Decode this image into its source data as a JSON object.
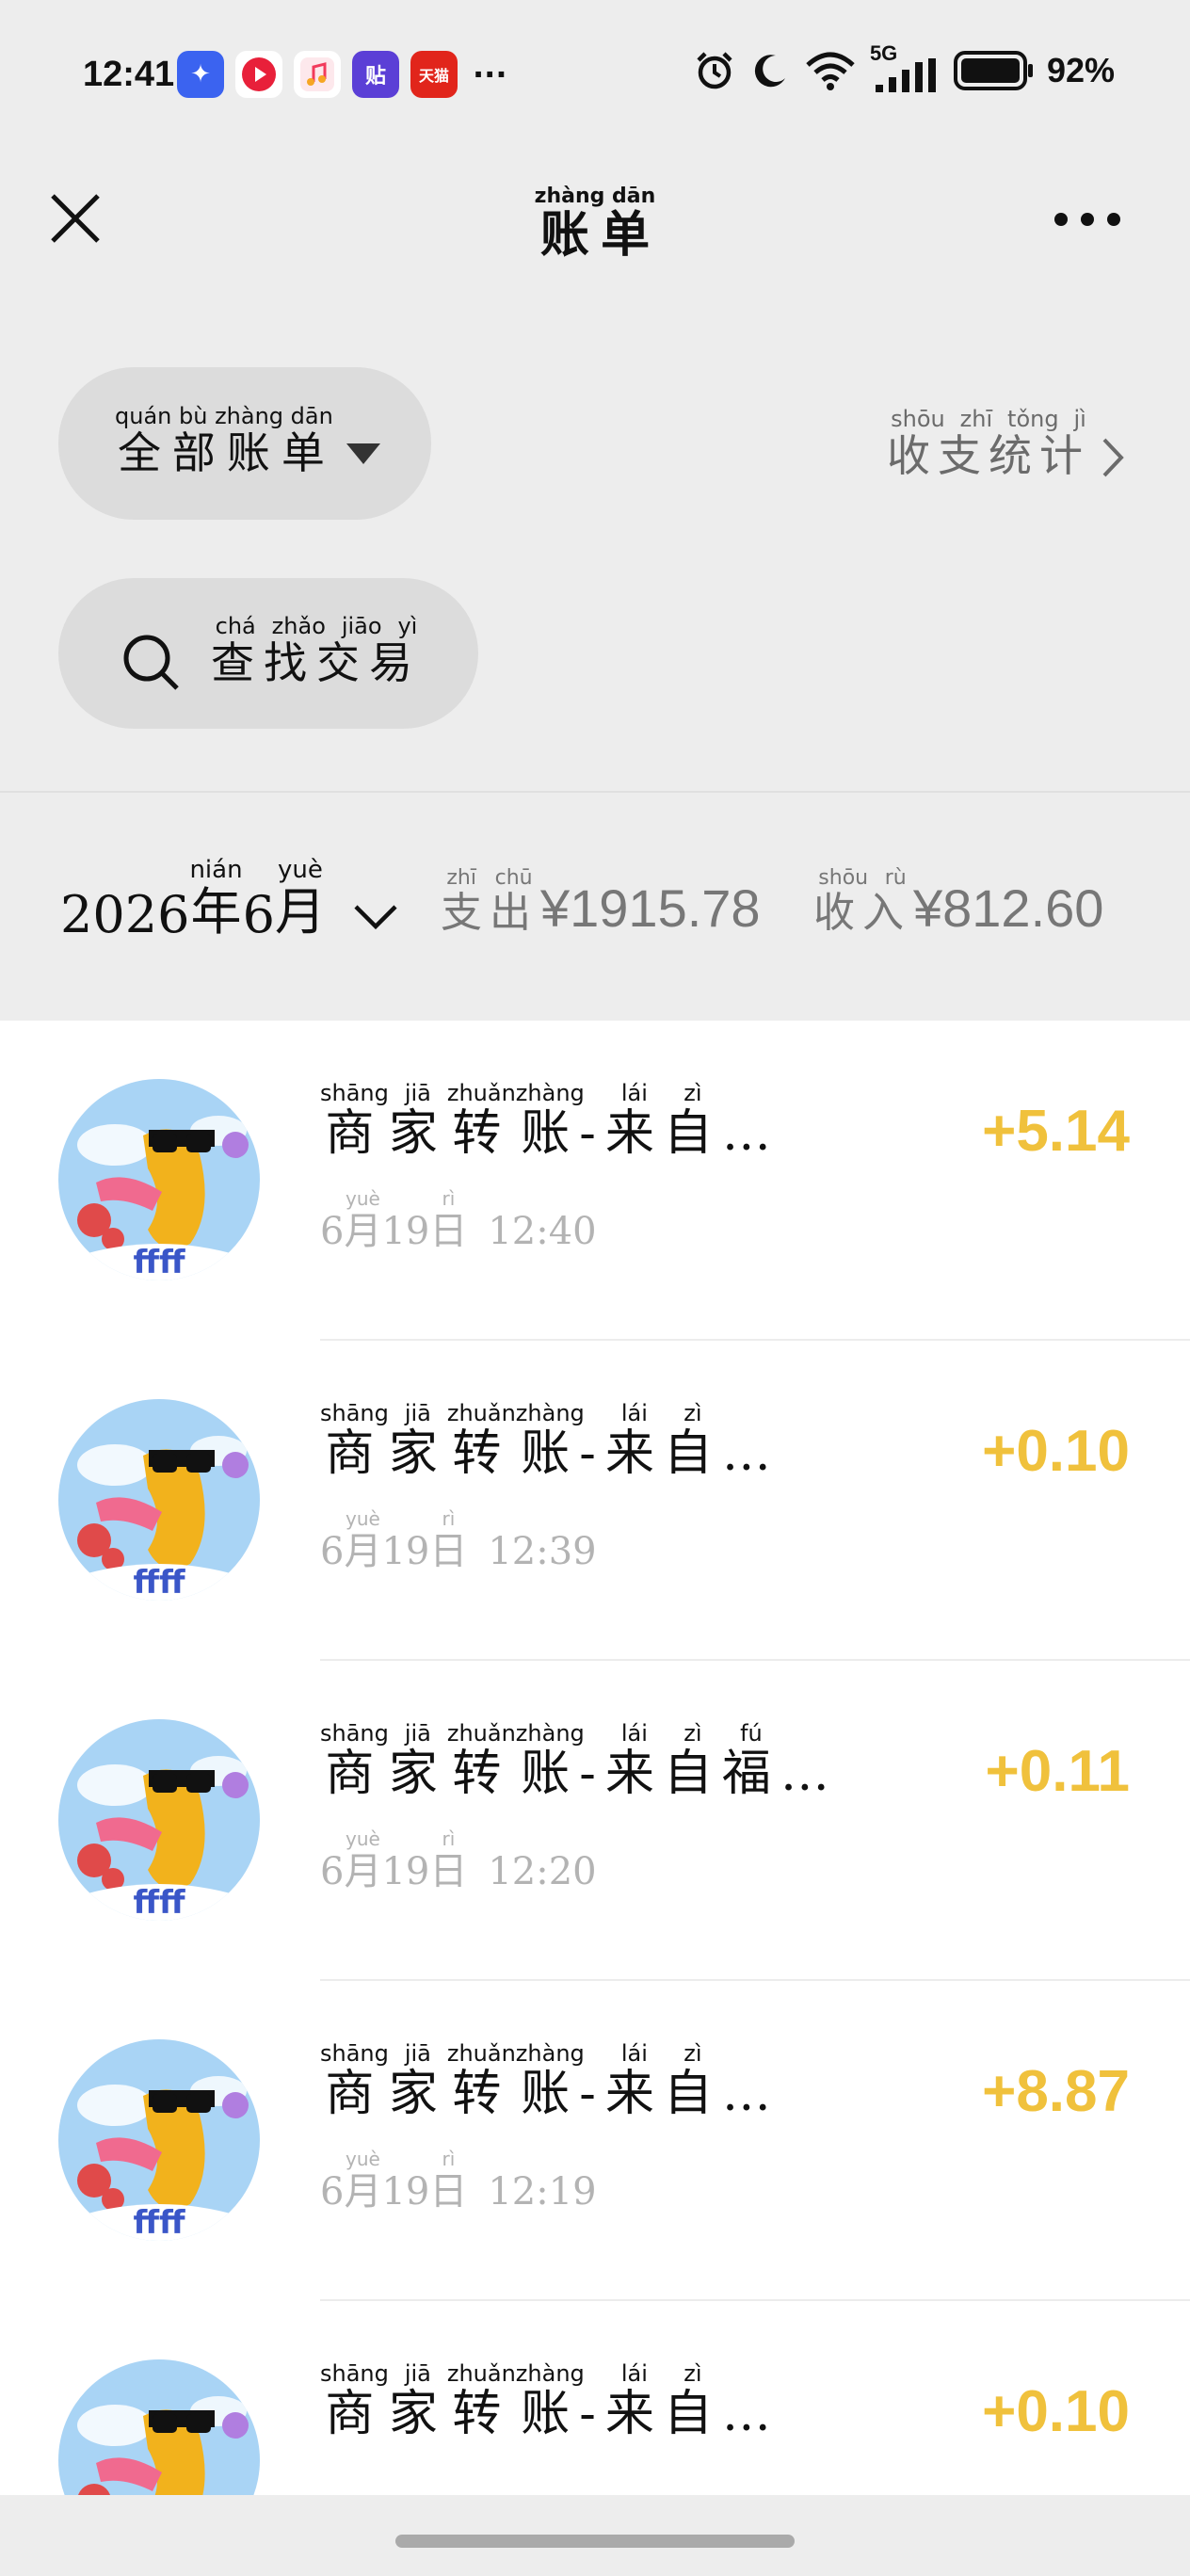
{
  "status_bar": {
    "time": "12:41",
    "network": "5G",
    "battery": "92%",
    "overflow": "···"
  },
  "nav": {
    "title": "账单",
    "title_pinyin": "zhàng dān"
  },
  "filter": {
    "all_bills": "全部账单",
    "all_bills_pinyin": "quán bù zhàng dān",
    "stats": "收支统计",
    "stats_pinyin": "shōu zhī tǒng jì",
    "search": "查找交易",
    "search_pinyin": "chá zhǎo jiāo yì"
  },
  "summary": {
    "year": "2026",
    "year_char": "年",
    "year_pinyin": "nián",
    "month": "6",
    "month_char": "月",
    "month_pinyin": "yuè",
    "expense_label": "支出",
    "expense_pinyin": "zhī chū",
    "expense_value": "¥1915.78",
    "income_label": "收入",
    "income_pinyin": "shōu rù",
    "income_value": "¥812.60"
  },
  "transactions": [
    {
      "title": "商家转账-来自…",
      "date_month": "6",
      "date_day": "19",
      "time": "12:40",
      "amount": "+5.14"
    },
    {
      "title": "商家转账-来自…",
      "date_month": "6",
      "date_day": "19",
      "time": "12:39",
      "amount": "+0.10"
    },
    {
      "title": "商家转账-来自福…",
      "date_month": "6",
      "date_day": "19",
      "time": "12:20",
      "amount": "+0.11"
    },
    {
      "title": "商家转账-来自…",
      "date_month": "6",
      "date_day": "19",
      "time": "12:19",
      "amount": "+8.87"
    },
    {
      "title": "商家转账-来自…",
      "date_month": "",
      "date_day": "",
      "time": "",
      "amount": "+0.10"
    }
  ],
  "colors": {
    "income_amount": "#f0c13c",
    "background": "#ededed"
  }
}
